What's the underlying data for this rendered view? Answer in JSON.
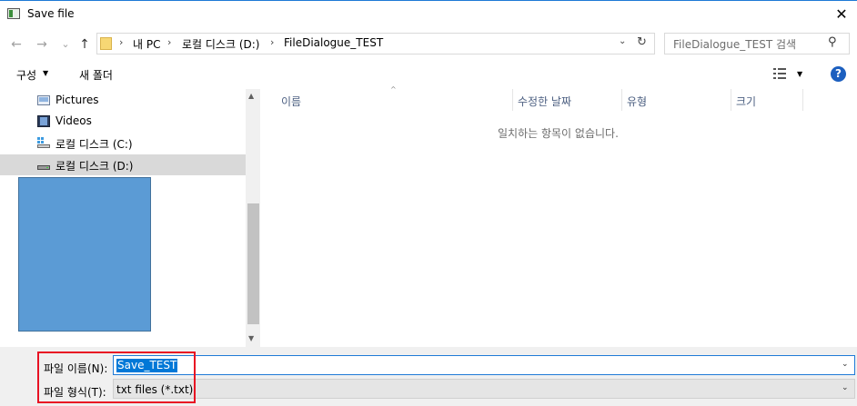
{
  "window": {
    "title": "Save file",
    "close_glyph": "✕"
  },
  "nav_buttons": {
    "back": "←",
    "forward": "→",
    "recent": "⌄",
    "up": "↑"
  },
  "address": {
    "separator": "›",
    "crumbs": [
      "내 PC",
      "로컬 디스크 (D:)",
      "FileDialogue_TEST"
    ],
    "dropdown_glyph": "⌄",
    "refresh_glyph": "↻"
  },
  "search": {
    "placeholder": "FileDialogue_TEST 검색",
    "icon_glyph": "⚲"
  },
  "toolbar": {
    "organize": "구성",
    "organize_caret": "▼",
    "new_folder": "새 폴더",
    "view_caret": "▼",
    "help": "?"
  },
  "nav_pane": {
    "items": [
      {
        "label": "Pictures",
        "icon": "pictures-icon"
      },
      {
        "label": "Videos",
        "icon": "videos-icon"
      },
      {
        "label": "로컬 디스크 (C:)",
        "icon": "windows-drive-icon"
      },
      {
        "label": "로컬 디스크 (D:)",
        "icon": "drive-icon",
        "selected": true
      }
    ],
    "scroll_up": "▲",
    "scroll_down": "▼"
  },
  "file_list": {
    "columns": [
      "이름",
      "수정한 날짜",
      "유형",
      "크기"
    ],
    "sort_caret": "^",
    "empty_message": "일치하는 항목이 없습니다."
  },
  "bottom": {
    "filename_label": "파일 이름(N):",
    "filename_value": "Save_TEST",
    "filetype_label": "파일 형식(T):",
    "filetype_value": "txt files (*.txt)",
    "caret": "⌄"
  },
  "colors": {
    "accent": "#0078d7",
    "highlight": "#e81123",
    "selection_bg": "#d9d9d9",
    "blue_shape": "#5b9bd5"
  }
}
